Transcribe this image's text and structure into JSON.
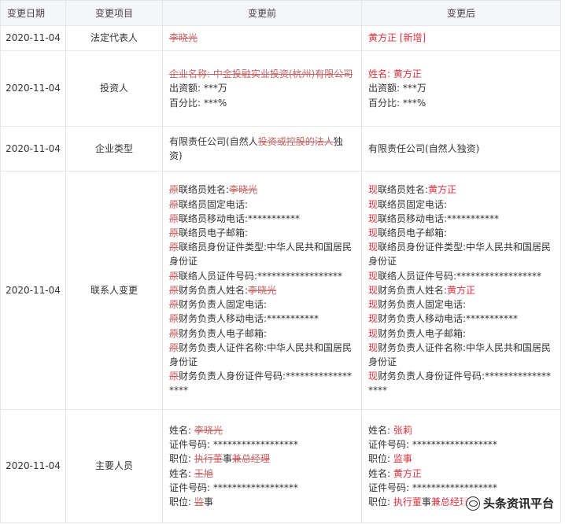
{
  "headers": {
    "date": "变更日期",
    "item": "变更项目",
    "before": "变更前",
    "after": "变更后"
  },
  "rows": [
    {
      "date": "2020-11-04",
      "item": "法定代表人",
      "before": [
        [
          {
            "t": "李晓光",
            "s": "del"
          }
        ]
      ],
      "after": [
        [
          {
            "t": "黄方正 [新增]",
            "s": "red"
          }
        ]
      ]
    },
    {
      "date": "2020-11-04",
      "item": "投资人",
      "before": [
        [
          {
            "t": "企业名称: 中金投融实业投资(杭州)有限公司",
            "s": "del"
          }
        ],
        [
          {
            "t": "出资额: ***万",
            "s": ""
          }
        ],
        [
          {
            "t": "百分比: ***%",
            "s": ""
          }
        ]
      ],
      "after": [
        [
          {
            "t": "姓名: ",
            "s": "red"
          },
          {
            "t": "黄方正",
            "s": "red"
          }
        ],
        [
          {
            "t": "出资额: ***万",
            "s": ""
          }
        ],
        [
          {
            "t": "百分比: ***%",
            "s": ""
          }
        ]
      ]
    },
    {
      "date": "2020-11-04",
      "item": "企业类型",
      "before": [
        [
          {
            "t": "有限责任公司(自然人",
            "s": ""
          },
          {
            "t": "投资或控股的法人",
            "s": "del"
          },
          {
            "t": "独资)",
            "s": ""
          }
        ]
      ],
      "after": [
        [
          {
            "t": "有限责任公司(自然人独资)",
            "s": ""
          }
        ]
      ]
    },
    {
      "date": "2020-11-04",
      "item": "联系人变更",
      "before": [
        [
          {
            "t": "原",
            "s": "del"
          },
          {
            "t": "联络员姓名:",
            "s": ""
          },
          {
            "t": "李晓光",
            "s": "del"
          }
        ],
        [
          {
            "t": "原",
            "s": "del"
          },
          {
            "t": "联络员固定电话:",
            "s": ""
          }
        ],
        [
          {
            "t": "原",
            "s": "del"
          },
          {
            "t": "联络员移动电话:***********",
            "s": ""
          }
        ],
        [
          {
            "t": "原",
            "s": "del"
          },
          {
            "t": "联络员电子邮箱:",
            "s": ""
          }
        ],
        [
          {
            "t": "原",
            "s": "del"
          },
          {
            "t": "联络员身份证件类型:中华人民共和国居民身份证",
            "s": ""
          }
        ],
        [
          {
            "t": "原",
            "s": "del"
          },
          {
            "t": "联络人员证件号码:******************",
            "s": ""
          }
        ],
        [
          {
            "t": "原",
            "s": "del"
          },
          {
            "t": "财务负责人姓名:",
            "s": ""
          },
          {
            "t": "李晓光",
            "s": "del"
          }
        ],
        [
          {
            "t": "原",
            "s": "del"
          },
          {
            "t": "财务负责人固定电话:",
            "s": ""
          }
        ],
        [
          {
            "t": "原",
            "s": "del"
          },
          {
            "t": "财务负责人移动电话:***********",
            "s": ""
          }
        ],
        [
          {
            "t": "原",
            "s": "del"
          },
          {
            "t": "财务负责人电子邮箱:",
            "s": ""
          }
        ],
        [
          {
            "t": "原",
            "s": "del"
          },
          {
            "t": "财务负责人证件名称:中华人民共和国居民身份证",
            "s": ""
          }
        ],
        [
          {
            "t": "原",
            "s": "del"
          },
          {
            "t": "财务负责人身份证件号码:******************",
            "s": ""
          }
        ]
      ],
      "after": [
        [
          {
            "t": "现",
            "s": "red"
          },
          {
            "t": "联络员姓名:",
            "s": ""
          },
          {
            "t": "黄方正",
            "s": "red"
          }
        ],
        [
          {
            "t": "现",
            "s": "red"
          },
          {
            "t": "联络员固定电话:",
            "s": ""
          }
        ],
        [
          {
            "t": "现",
            "s": "red"
          },
          {
            "t": "联络员移动电话:***********",
            "s": ""
          }
        ],
        [
          {
            "t": "现",
            "s": "red"
          },
          {
            "t": "联络员电子邮箱:",
            "s": ""
          }
        ],
        [
          {
            "t": "现",
            "s": "red"
          },
          {
            "t": "联络员身份证件类型:中华人民共和国居民身份证",
            "s": ""
          }
        ],
        [
          {
            "t": "现",
            "s": "red"
          },
          {
            "t": "联络人员证件号码:******************",
            "s": ""
          }
        ],
        [
          {
            "t": "现",
            "s": "red"
          },
          {
            "t": "财务负责人姓名:",
            "s": ""
          },
          {
            "t": "黄方正",
            "s": "red"
          }
        ],
        [
          {
            "t": "现",
            "s": "red"
          },
          {
            "t": "财务负责人固定电话:",
            "s": ""
          }
        ],
        [
          {
            "t": "现",
            "s": "red"
          },
          {
            "t": "财务负责人移动电话:***********",
            "s": ""
          }
        ],
        [
          {
            "t": "现",
            "s": "red"
          },
          {
            "t": "财务负责人电子邮箱:",
            "s": ""
          }
        ],
        [
          {
            "t": "现",
            "s": "red"
          },
          {
            "t": "财务负责人证件名称:中华人民共和国居民身份证",
            "s": ""
          }
        ],
        [
          {
            "t": "现",
            "s": "red"
          },
          {
            "t": "财务负责人身份证件号码:******************",
            "s": ""
          }
        ]
      ]
    },
    {
      "date": "2020-11-04",
      "item": "主要人员",
      "before": [
        [
          {
            "t": "姓名: ",
            "s": ""
          },
          {
            "t": "李晓光",
            "s": "del"
          }
        ],
        [
          {
            "t": "证件号码: ******************",
            "s": ""
          }
        ],
        [
          {
            "t": "职位: ",
            "s": ""
          },
          {
            "t": "执行董",
            "s": "del"
          },
          {
            "t": "事",
            "s": ""
          },
          {
            "t": "兼总经理",
            "s": "del"
          }
        ],
        [
          {
            "t": "姓名: ",
            "s": ""
          },
          {
            "t": "王旭",
            "s": "del"
          }
        ],
        [
          {
            "t": "证件号码: ******************",
            "s": ""
          }
        ],
        [
          {
            "t": "职位: ",
            "s": ""
          },
          {
            "t": "监",
            "s": "del"
          },
          {
            "t": "事",
            "s": ""
          }
        ]
      ],
      "after": [
        [
          {
            "t": "姓名: ",
            "s": ""
          },
          {
            "t": "张莉",
            "s": "red"
          }
        ],
        [
          {
            "t": "证件号码: ******************",
            "s": ""
          }
        ],
        [
          {
            "t": "职位: ",
            "s": ""
          },
          {
            "t": "监事",
            "s": "red"
          }
        ],
        [
          {
            "t": "姓名: ",
            "s": ""
          },
          {
            "t": "黄方正",
            "s": "red"
          }
        ],
        [
          {
            "t": "证件号码: ******************",
            "s": ""
          }
        ],
        [
          {
            "t": "职位: ",
            "s": ""
          },
          {
            "t": "执行董",
            "s": "red"
          },
          {
            "t": "事",
            "s": ""
          },
          {
            "t": "兼总经理",
            "s": "red"
          }
        ]
      ]
    }
  ],
  "watermark": {
    "text": "头条资讯平台",
    "icon": "wechat-logo-icon"
  },
  "colors": {
    "deleted": "#c46262",
    "added": "#e0313e",
    "header_bg": "#f4f6fa",
    "border": "#e3e6ec"
  }
}
